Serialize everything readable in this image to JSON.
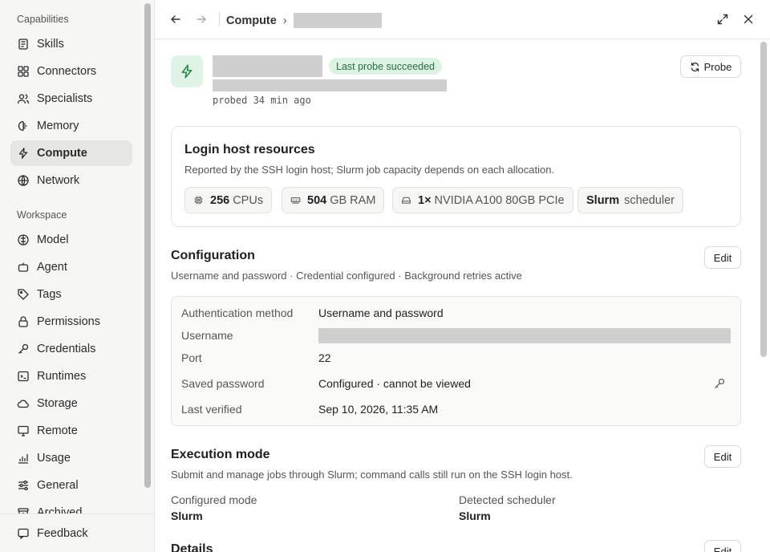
{
  "sidebar": {
    "sections": [
      {
        "title": "Capabilities",
        "items": [
          {
            "label": "Skills",
            "icon": "skills-icon"
          },
          {
            "label": "Connectors",
            "icon": "connectors-icon"
          },
          {
            "label": "Specialists",
            "icon": "specialists-icon"
          },
          {
            "label": "Memory",
            "icon": "memory-icon"
          },
          {
            "label": "Compute",
            "icon": "compute-icon",
            "active": true
          },
          {
            "label": "Network",
            "icon": "globe-icon"
          }
        ]
      },
      {
        "title": "Workspace",
        "items": [
          {
            "label": "Model",
            "icon": "model-icon"
          },
          {
            "label": "Agent",
            "icon": "agent-icon"
          },
          {
            "label": "Tags",
            "icon": "tag-icon"
          },
          {
            "label": "Permissions",
            "icon": "lock-icon"
          },
          {
            "label": "Credentials",
            "icon": "key-icon"
          },
          {
            "label": "Runtimes",
            "icon": "terminal-icon"
          },
          {
            "label": "Storage",
            "icon": "cloud-icon"
          },
          {
            "label": "Remote",
            "icon": "monitor-icon"
          },
          {
            "label": "Usage",
            "icon": "chart-icon"
          },
          {
            "label": "General",
            "icon": "sliders-icon"
          },
          {
            "label": "Archived",
            "icon": "archive-icon"
          }
        ]
      }
    ],
    "footer": {
      "label": "Feedback"
    }
  },
  "topbar": {
    "breadcrumb_root": "Compute",
    "breadcrumb_sep": "›"
  },
  "header": {
    "badge": "Last probe succeeded",
    "probed": "probed 34 min ago",
    "probe_button": "Probe"
  },
  "resources": {
    "title": "Login host resources",
    "subtitle": "Reported by the SSH login host; Slurm job capacity depends on each allocation.",
    "chips": [
      {
        "value": "256",
        "unit": "CPUs",
        "icon": "cpu-icon"
      },
      {
        "value": "504",
        "unit": "GB RAM",
        "icon": "memory-chip-icon"
      },
      {
        "value": "1×",
        "unit": "NVIDIA A100 80GB PCIe",
        "icon": "gpu-icon"
      },
      {
        "value": "Slurm",
        "unit": "scheduler",
        "icon": ""
      }
    ]
  },
  "configuration": {
    "title": "Configuration",
    "subtitle": "Username and password · Credential configured · Background retries active",
    "edit_label": "Edit",
    "rows": [
      {
        "key": "Authentication method",
        "value": "Username and password"
      },
      {
        "key": "Username",
        "value": ""
      },
      {
        "key": "Port",
        "value": "22"
      },
      {
        "key": "Saved password",
        "value": "Configured · cannot be viewed"
      },
      {
        "key": "Last verified",
        "value": "Sep 10, 2026, 11:35 AM"
      }
    ]
  },
  "execution": {
    "title": "Execution mode",
    "subtitle": "Submit and manage jobs through Slurm; command calls still run on the SSH login host.",
    "edit_label": "Edit",
    "configured_mode_label": "Configured mode",
    "configured_mode_value": "Slurm",
    "detected_scheduler_label": "Detected scheduler",
    "detected_scheduler_value": "Slurm"
  },
  "details": {
    "title": "Details",
    "edit_label": "Edit"
  }
}
